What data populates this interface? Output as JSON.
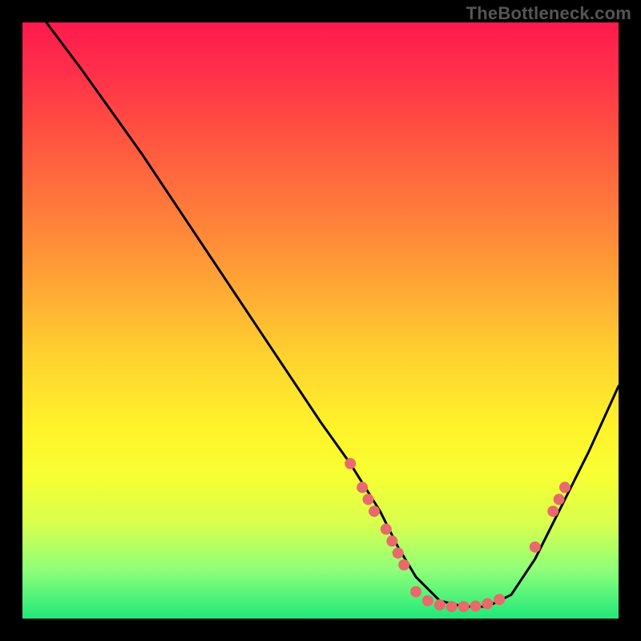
{
  "watermark": "TheBottleneck.com",
  "chart_data": {
    "type": "line",
    "title": "",
    "xlabel": "",
    "ylabel": "",
    "xlim": [
      0,
      100
    ],
    "ylim": [
      0,
      100
    ],
    "series": [
      {
        "name": "bottleneck-curve",
        "x": [
          4,
          10,
          20,
          30,
          40,
          50,
          55,
          60,
          63,
          66,
          70,
          74,
          78,
          82,
          86,
          90,
          95,
          100
        ],
        "y": [
          100,
          92,
          78,
          63,
          48,
          33,
          26,
          18,
          12,
          7,
          3,
          2,
          2,
          4,
          10,
          18,
          28,
          39
        ]
      }
    ],
    "markers": [
      {
        "x": 55,
        "y": 26
      },
      {
        "x": 57,
        "y": 22
      },
      {
        "x": 58,
        "y": 20
      },
      {
        "x": 59,
        "y": 18
      },
      {
        "x": 61,
        "y": 15
      },
      {
        "x": 62,
        "y": 13
      },
      {
        "x": 63,
        "y": 11
      },
      {
        "x": 64,
        "y": 9
      },
      {
        "x": 66,
        "y": 4.5
      },
      {
        "x": 68,
        "y": 3
      },
      {
        "x": 70,
        "y": 2.3
      },
      {
        "x": 72,
        "y": 2
      },
      {
        "x": 74,
        "y": 2
      },
      {
        "x": 76,
        "y": 2.1
      },
      {
        "x": 78,
        "y": 2.5
      },
      {
        "x": 80,
        "y": 3.2
      },
      {
        "x": 86,
        "y": 12
      },
      {
        "x": 89,
        "y": 18
      },
      {
        "x": 90,
        "y": 20
      },
      {
        "x": 91,
        "y": 22
      }
    ],
    "colors": {
      "curve": "#000000",
      "markers": "#e86a6a"
    }
  }
}
